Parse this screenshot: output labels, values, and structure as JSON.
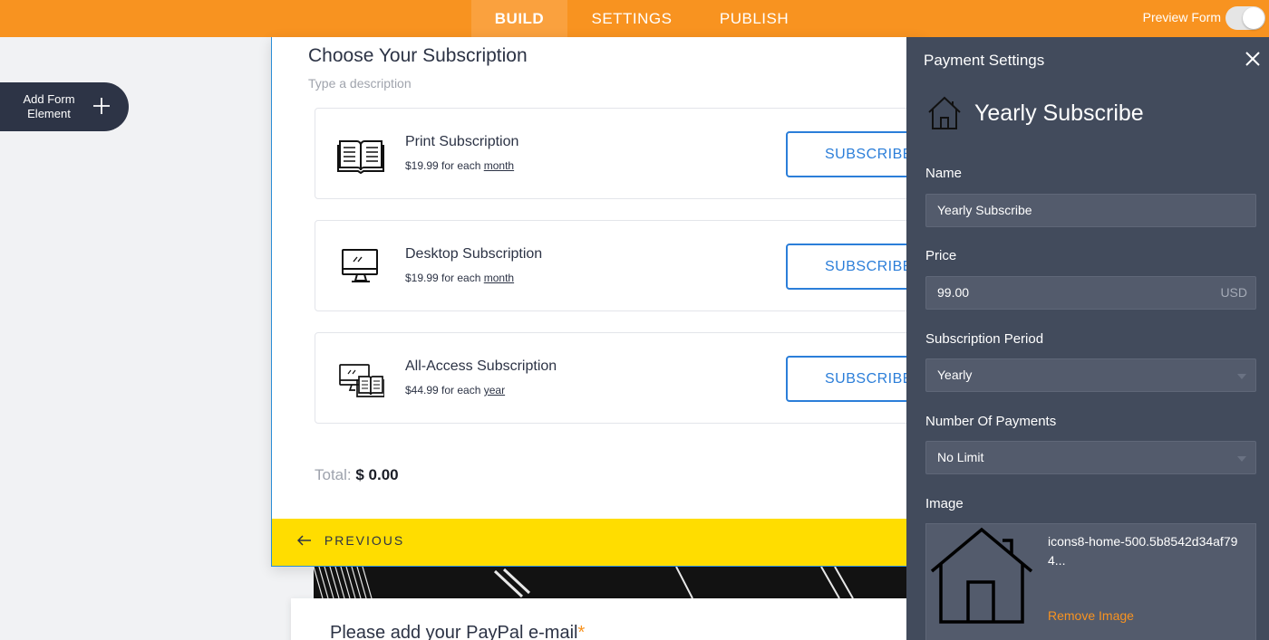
{
  "topbar": {
    "tabs": [
      {
        "label": "BUILD",
        "active": true
      },
      {
        "label": "SETTINGS",
        "active": false
      },
      {
        "label": "PUBLISH",
        "active": false
      }
    ],
    "preview_label": "Preview Form",
    "preview_enabled": false,
    "colors": {
      "bar": "#f89320"
    }
  },
  "add_element": {
    "label": "Add Form Element",
    "icon": "plus-icon"
  },
  "form": {
    "title": "Choose Your Subscription",
    "description_placeholder": "Type a description",
    "products": [
      {
        "name": "Print Subscription",
        "price": "$19.99",
        "for_each": "for each",
        "period": "month",
        "icon": "book-icon",
        "button": "SUBSCRIBE"
      },
      {
        "name": "Desktop Subscription",
        "price": "$19.99",
        "for_each": "for each",
        "period": "month",
        "icon": "desktop-icon",
        "button": "SUBSCRIBE"
      },
      {
        "name": "All-Access Subscription",
        "price": "$44.99",
        "for_each": "for each",
        "period": "year",
        "icon": "desktop-book-icon",
        "button": "SUBSCRIBE"
      }
    ],
    "total_label": "Total:",
    "total_value": "$ 0.00",
    "previous_label": "PREVIOUS",
    "colors": {
      "accent": "#2b7ed9",
      "footer": "#ffdd00"
    }
  },
  "paypal": {
    "label": "Please add your PayPal e-mail",
    "required_mark": "*"
  },
  "panel": {
    "title": "Payment Settings",
    "heading": "Yearly Subscribe",
    "heading_icon": "home-icon",
    "name_label": "Name",
    "name_value": "Yearly Subscribe",
    "price_label": "Price",
    "price_value": "99.00",
    "price_currency": "USD",
    "period_label": "Subscription Period",
    "period_value": "Yearly",
    "payments_label": "Number Of Payments",
    "payments_value": "No Limit",
    "image_label": "Image",
    "image_filename": "icons8-home-500.5b8542d34af794...",
    "remove_image": "Remove Image",
    "colors": {
      "background": "#424b5c",
      "link": "#f89320"
    }
  }
}
